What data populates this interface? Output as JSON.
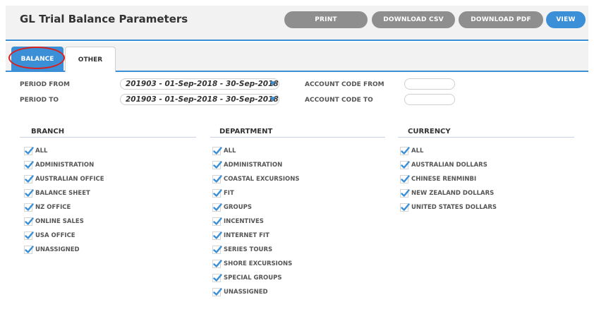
{
  "header": {
    "title": "GL Trial Balance Parameters",
    "print_label": "PRINT",
    "csv_label": "DOWNLOAD CSV",
    "pdf_label": "DOWNLOAD PDF",
    "view_label": "VIEW"
  },
  "tabs": [
    {
      "label": "BALANCE",
      "active": true
    },
    {
      "label": "OTHER",
      "active": false
    }
  ],
  "params": {
    "period_from_label": "PERIOD FROM",
    "period_from_value": "201903 - 01-Sep-2018 - 30-Sep-2018",
    "period_to_label": "PERIOD TO",
    "period_to_value": "201903 - 01-Sep-2018 - 30-Sep-2018",
    "account_from_label": "ACCOUNT CODE FROM",
    "account_from_value": "",
    "account_to_label": "ACCOUNT CODE TO",
    "account_to_value": ""
  },
  "branch": {
    "heading": "BRANCH",
    "items": [
      "ALL",
      "ADMINISTRATION",
      "AUSTRALIAN OFFICE",
      "BALANCE SHEET",
      "NZ OFFICE",
      "ONLINE SALES",
      "USA OFFICE",
      "UNASSIGNED"
    ]
  },
  "department": {
    "heading": "DEPARTMENT",
    "items": [
      "ALL",
      "ADMINISTRATION",
      "COASTAL EXCURSIONS",
      "FIT",
      "GROUPS",
      "INCENTIVES",
      "INTERNET FIT",
      "SERIES TOURS",
      "SHORE EXCURSIONS",
      "SPECIAL GROUPS",
      "UNASSIGNED"
    ]
  },
  "currency": {
    "heading": "CURRENCY",
    "items": [
      "ALL",
      "AUSTRALIAN DOLLARS",
      "CHINESE RENMINBI",
      "NEW ZEALAND DOLLARS",
      "UNITED STATES DOLLARS"
    ]
  },
  "colors": {
    "accent": "#3a8fd6",
    "button_gray": "#8e8e8e",
    "annotation": "#d92020"
  },
  "icons": {
    "check": "checkmark-icon",
    "dropdown": "chevron-down-icon"
  }
}
